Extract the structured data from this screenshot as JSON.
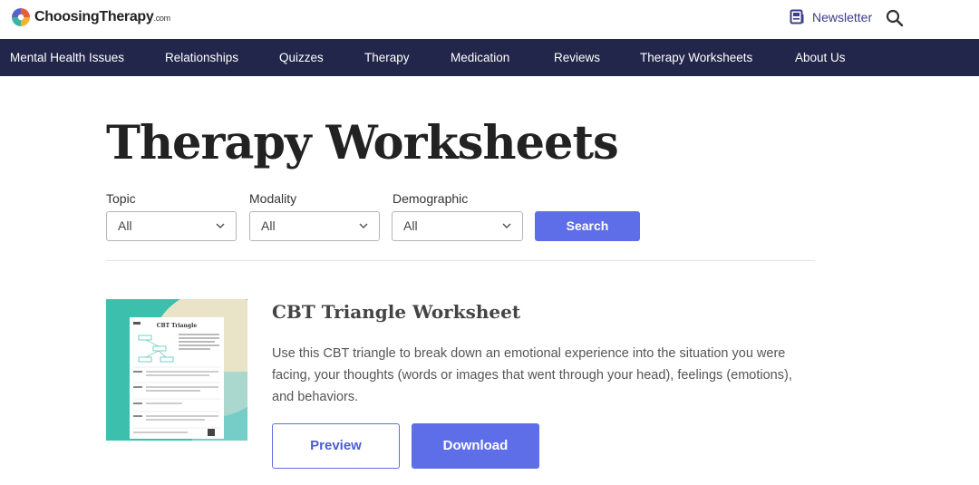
{
  "header": {
    "logo_text": "ChoosingTherapy",
    "logo_suffix": ".com",
    "newsletter_label": "Newsletter",
    "icons": {
      "logo": "choosingtherapy-logo-icon",
      "newsletter": "newsletter-icon",
      "search": "search-icon"
    }
  },
  "nav": {
    "items": [
      {
        "label": "Mental Health Issues"
      },
      {
        "label": "Relationships"
      },
      {
        "label": "Quizzes"
      },
      {
        "label": "Therapy"
      },
      {
        "label": "Medication"
      },
      {
        "label": "Reviews"
      },
      {
        "label": "Therapy Worksheets"
      },
      {
        "label": "About Us"
      }
    ]
  },
  "main": {
    "title": "Therapy Worksheets",
    "filters": [
      {
        "label": "Topic",
        "value": "All"
      },
      {
        "label": "Modality",
        "value": "All"
      },
      {
        "label": "Demographic",
        "value": "All"
      }
    ],
    "search_label": "Search"
  },
  "worksheet": {
    "title": "CBT Triangle Worksheet",
    "description": "Use this CBT triangle to break down an emotional experience into the situation you were facing, your thoughts (words or images that went through your head), feelings (emotions), and behaviors.",
    "preview_label": "Preview",
    "download_label": "Download",
    "thumbnail_title": "CBT Triangle"
  },
  "colors": {
    "nav_bg": "#22264a",
    "accent": "#5e6ee9",
    "newsletter": "#3a3e8c",
    "thumbnail_teal": "#3dbfae"
  }
}
